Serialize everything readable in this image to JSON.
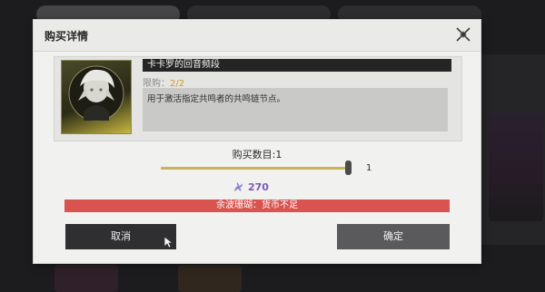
{
  "background": {
    "tabs": [
      "",
      "",
      ""
    ]
  },
  "dialog": {
    "title": "购买详情",
    "close_icon": "close-x-icon"
  },
  "item": {
    "name": "卡卡罗的回音频段",
    "limit_label": "限购：",
    "limit_value": "2/2",
    "description": "用于激活指定共鸣者的共鸣链节点。",
    "icon": "character-portrait-icon"
  },
  "purchase": {
    "quantity_label": "购买数目:1",
    "quantity_current": 1,
    "quantity_min": 1,
    "quantity_max": 1,
    "max_label": "1",
    "currency_icon": "coral-currency-icon",
    "cost": "270"
  },
  "warning": {
    "text": "余波珊瑚：货币不足"
  },
  "buttons": {
    "cancel": "取消",
    "confirm": "确定"
  },
  "colors": {
    "warning": "#d9534f",
    "limit_value": "#c99a2a",
    "cost": "#7a5ab8",
    "slider": "#c8b25a"
  }
}
